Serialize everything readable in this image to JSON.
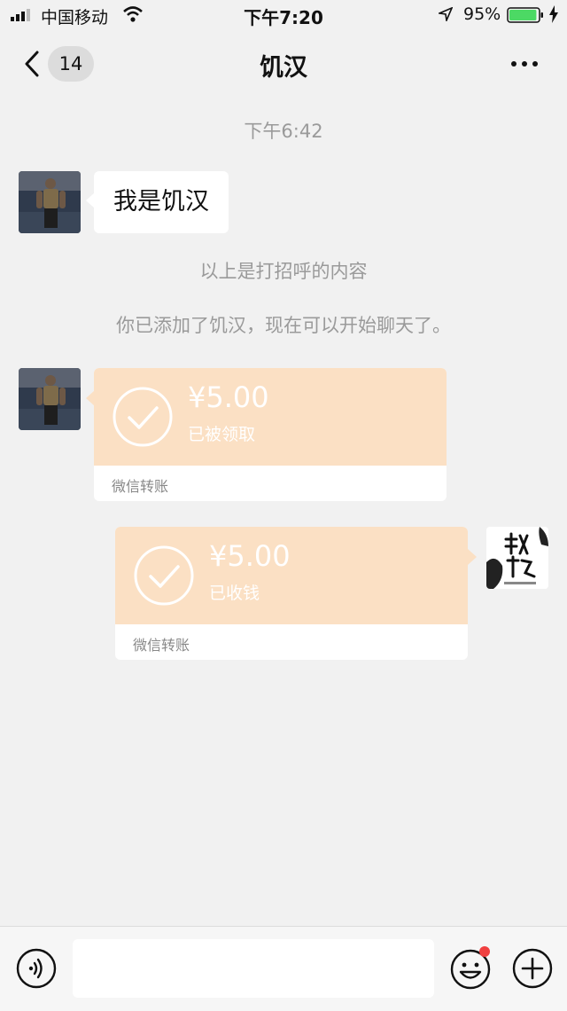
{
  "status_bar": {
    "carrier": "中国移动",
    "time": "下午7:20",
    "battery_percent": "95%",
    "battery_level": 0.95,
    "icons": [
      "signal-icon",
      "wifi-icon",
      "location-icon",
      "battery-icon",
      "charging-icon"
    ]
  },
  "nav": {
    "unread_count": "14",
    "title": "饥汉",
    "icons": [
      "back-chevron-icon",
      "more-icon"
    ]
  },
  "chat": {
    "timestamp": "下午6:42",
    "greeting_message": "我是饥汉",
    "system_notice_1": "以上是打招呼的内容",
    "system_notice_2": "你已添加了饥汉，现在可以开始聊天了。",
    "transfers": [
      {
        "amount": "¥5.00",
        "status": "已被领取",
        "footer": "微信转账"
      },
      {
        "amount": "¥5.00",
        "status": "已收钱",
        "footer": "微信转账"
      }
    ]
  },
  "input_bar": {
    "placeholder": "",
    "icons": [
      "voice-icon",
      "emoji-icon",
      "plus-icon"
    ]
  },
  "colors": {
    "background": "#f1f1f1",
    "transfer_bg": "#fbe0c4",
    "notification_dot": "#f04040",
    "battery_green": "#4cd964"
  }
}
